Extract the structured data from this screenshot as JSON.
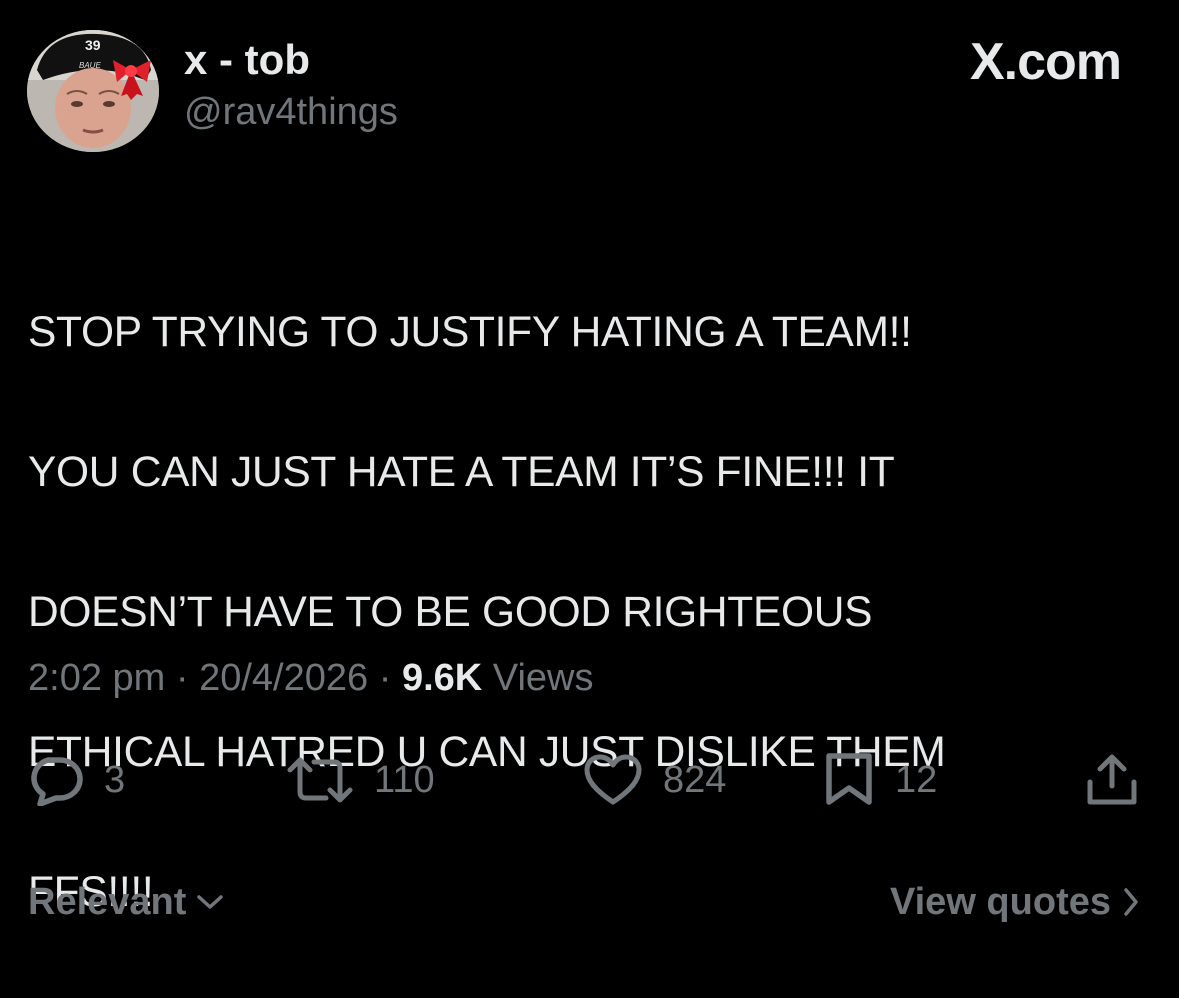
{
  "author": {
    "display_name": "x - tob",
    "handle": "@rav4things",
    "avatar_icon": "avatar-hockey-player-with-bow",
    "avatar_jersey_number": "39"
  },
  "brand": "X.com",
  "tweet": {
    "lines": [
      "STOP TRYING TO JUSTIFY HATING A TEAM!!",
      "YOU CAN JUST HATE A TEAM IT’S FINE!!! IT",
      "DOESN’T HAVE TO BE GOOD RIGHTEOUS",
      "ETHICAL HATRED U CAN JUST DISLIKE THEM",
      "FFS!!!!"
    ]
  },
  "meta": {
    "time": "2:02 pm",
    "separator": " · ",
    "date": "20/4/2026",
    "views_count": "9.6K",
    "views_label": "Views"
  },
  "actions": {
    "replies": "3",
    "reposts": "110",
    "likes": "824",
    "bookmarks": "12"
  },
  "footer": {
    "sort_label": "Relevant",
    "quotes_label": "View quotes"
  },
  "colors": {
    "background": "#000000",
    "primary_text": "#e7e9ea",
    "secondary_text": "#71767b"
  }
}
